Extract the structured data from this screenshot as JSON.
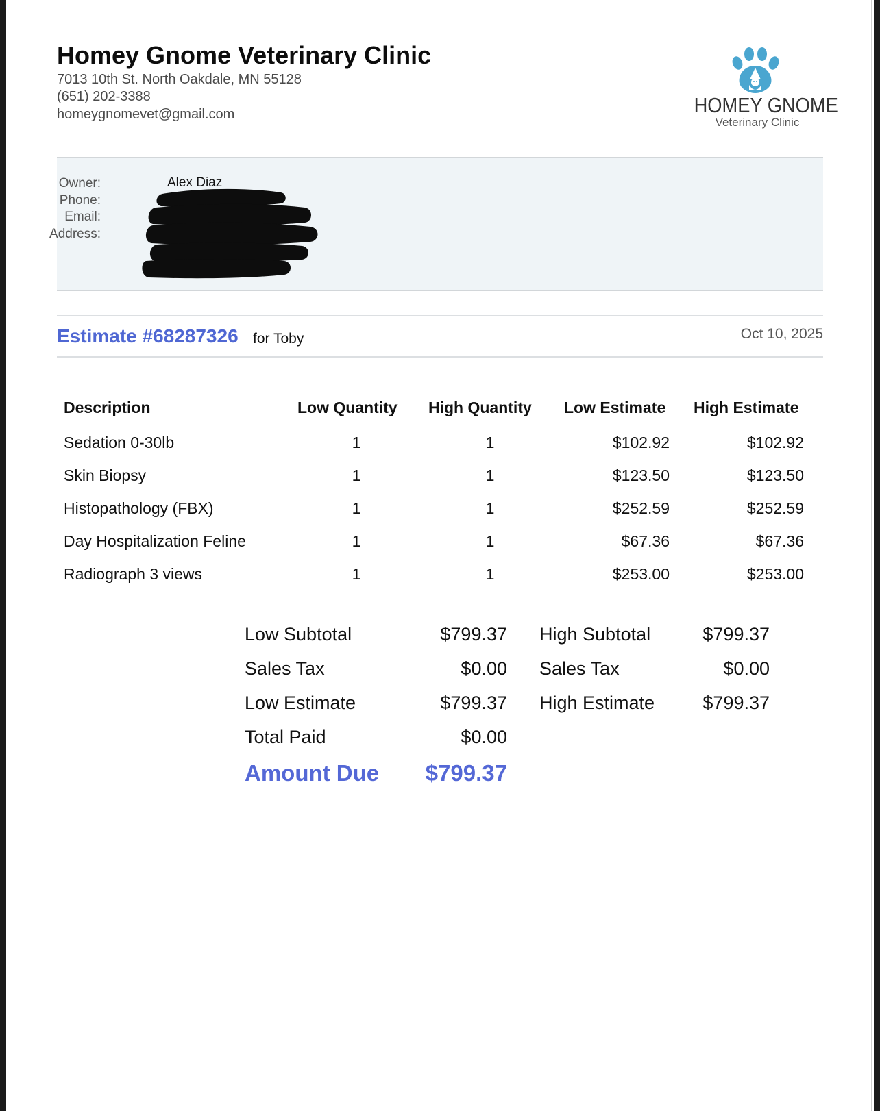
{
  "clinic": {
    "name": "Homey Gnome Veterinary Clinic",
    "address": "7013 10th St. North Oakdale, MN 55128",
    "phone": "(651) 202-3388",
    "email": "homeygnomevet@gmail.com"
  },
  "logo": {
    "title": "HOMEY GNOME",
    "subtitle": "Veterinary Clinic",
    "icon": "paw-gnome-icon",
    "color": "#4aa6d0"
  },
  "owner": {
    "owner_label": "Owner:",
    "owner_value": "Alex Diaz",
    "phone_label": "Phone:",
    "email_label": "Email:",
    "address_label": "Address:"
  },
  "estimate": {
    "title": "Estimate #68287326",
    "for_text": "for Toby",
    "date": "Oct 10, 2025"
  },
  "table": {
    "headers": [
      "Description",
      "Low Quantity",
      "High Quantity",
      "Low Estimate",
      "High Estimate"
    ],
    "rows": [
      [
        "Sedation 0-30lb",
        "1",
        "1",
        "$102.92",
        "$102.92"
      ],
      [
        "Skin Biopsy",
        "1",
        "1",
        "$123.50",
        "$123.50"
      ],
      [
        "Histopathology (FBX)",
        "1",
        "1",
        "$252.59",
        "$252.59"
      ],
      [
        "Day Hospitalization Feline",
        "1",
        "1",
        "$67.36",
        "$67.36"
      ],
      [
        "Radiograph 3 views",
        "1",
        "1",
        "$253.00",
        "$253.00"
      ]
    ]
  },
  "totals": {
    "low": [
      {
        "label": "Low Subtotal",
        "value": "$799.37"
      },
      {
        "label": "Sales Tax",
        "value": "$0.00"
      },
      {
        "label": "Low Estimate",
        "value": "$799.37"
      },
      {
        "label": "Total Paid",
        "value": "$0.00"
      }
    ],
    "high": [
      {
        "label": "High Subtotal",
        "value": "$799.37"
      },
      {
        "label": "Sales Tax",
        "value": "$0.00"
      },
      {
        "label": "High Estimate",
        "value": "$799.37"
      }
    ],
    "amount_due_label": "Amount Due",
    "amount_due_value": "$799.37"
  },
  "colors": {
    "accent": "#4f67d3",
    "owner_box_bg": "#eff4f7"
  }
}
